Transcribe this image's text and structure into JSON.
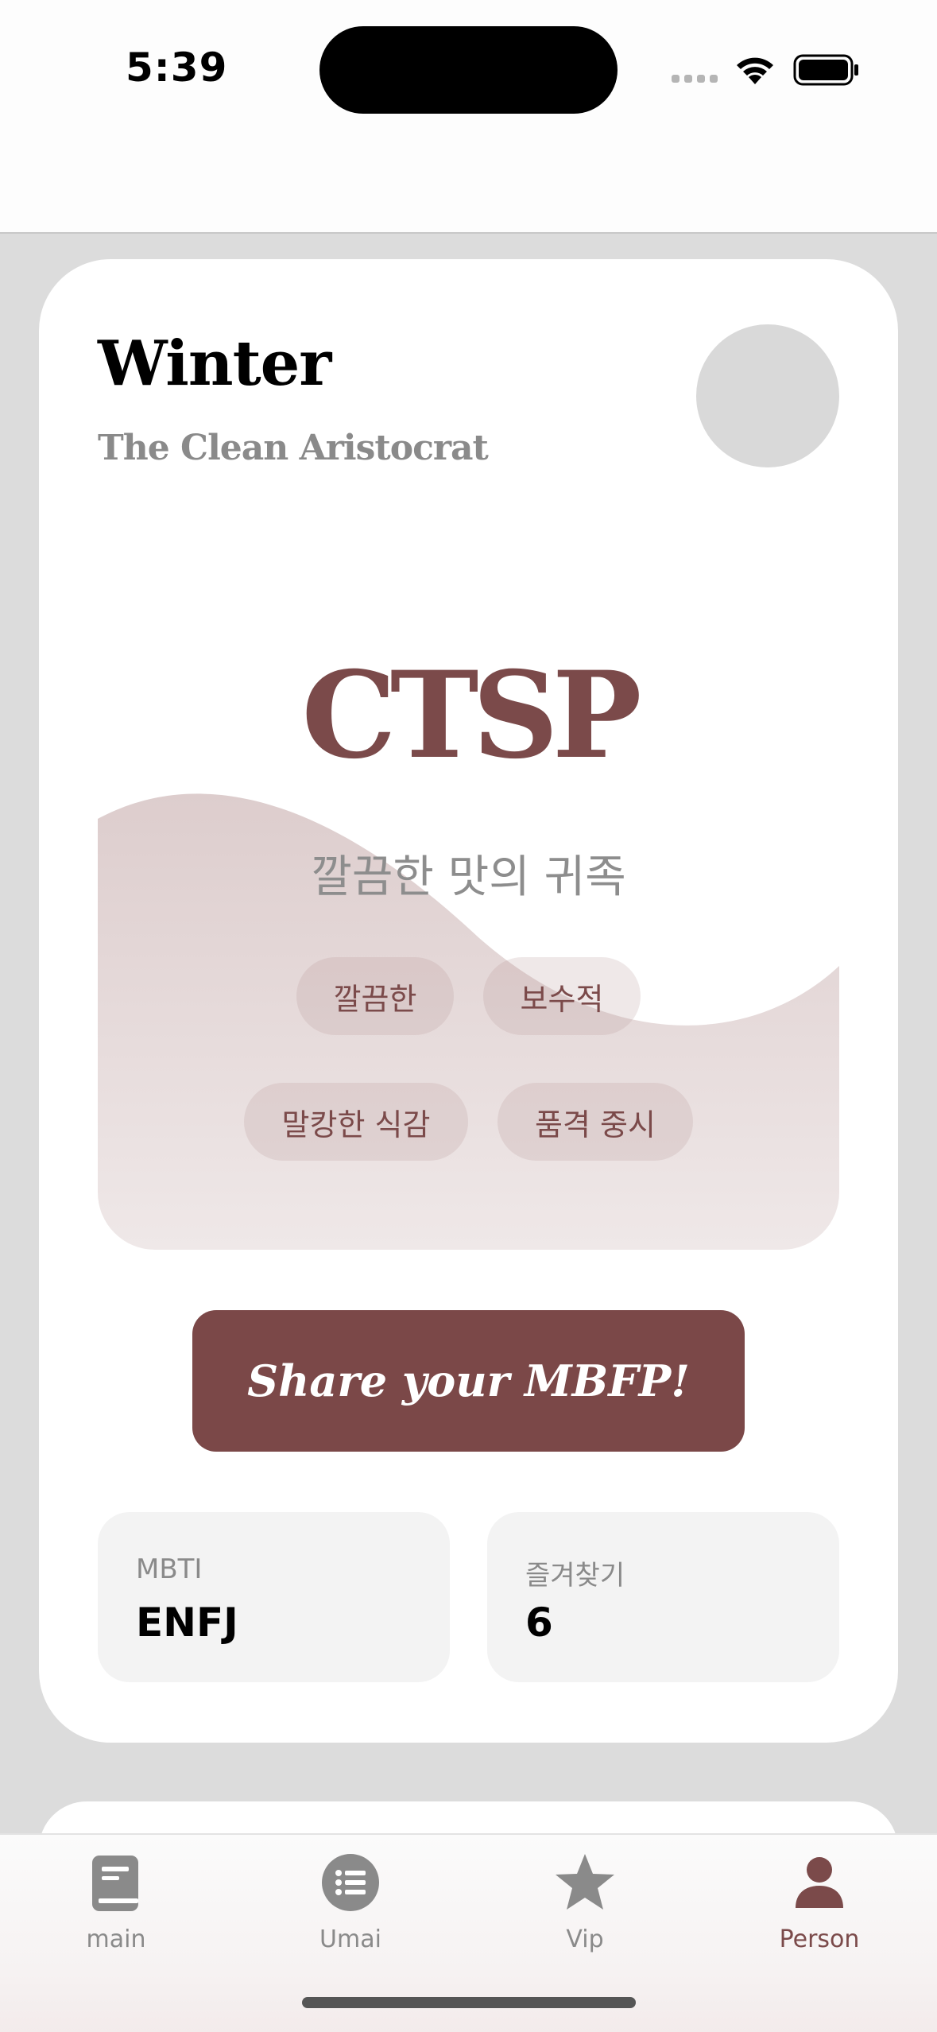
{
  "status_bar": {
    "time": "5:39"
  },
  "profile": {
    "name": "Winter",
    "subtitle": "The Clean Aristocrat"
  },
  "type_card": {
    "code": "CTSP",
    "korean_title": "깔끔한 맛의 귀족",
    "chips": [
      "깔끔한",
      "보수적",
      "말캉한 식감",
      "품격 중시"
    ]
  },
  "share_button": {
    "label": "Share your MBFP!"
  },
  "stats": [
    {
      "label": "MBTI",
      "value": "ENFJ"
    },
    {
      "label": "즐겨찾기",
      "value": "6"
    }
  ],
  "tab_bar": {
    "tabs": [
      {
        "label": "main",
        "icon": "book-icon"
      },
      {
        "label": "Umai",
        "icon": "list-circle-icon"
      },
      {
        "label": "Vip",
        "icon": "star-icon"
      },
      {
        "label": "Person",
        "icon": "person-icon"
      }
    ],
    "active": "Person"
  },
  "colors": {
    "accent": "#7b4a4a",
    "card_bg": "#ffffff",
    "page_bg": "#dcdcdc",
    "chip_bg": "#ece3e3"
  }
}
